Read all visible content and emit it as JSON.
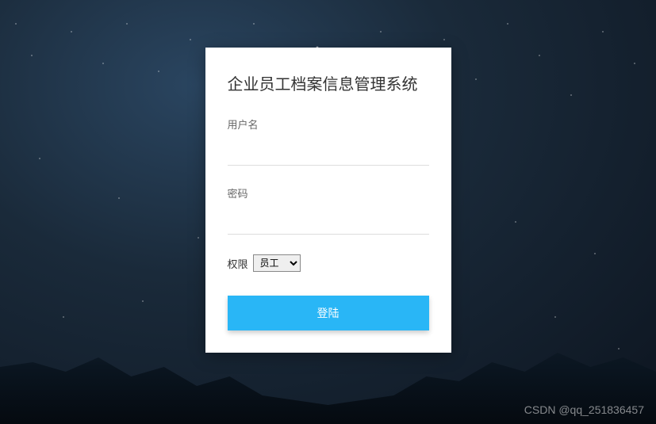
{
  "title": "企业员工档案信息管理系统",
  "form": {
    "username_label": "用户名",
    "username_value": "",
    "password_label": "密码",
    "password_value": "",
    "role_label": "权限",
    "role_selected": "员工",
    "login_button": "登陆"
  },
  "watermark": "CSDN @qq_251836457"
}
